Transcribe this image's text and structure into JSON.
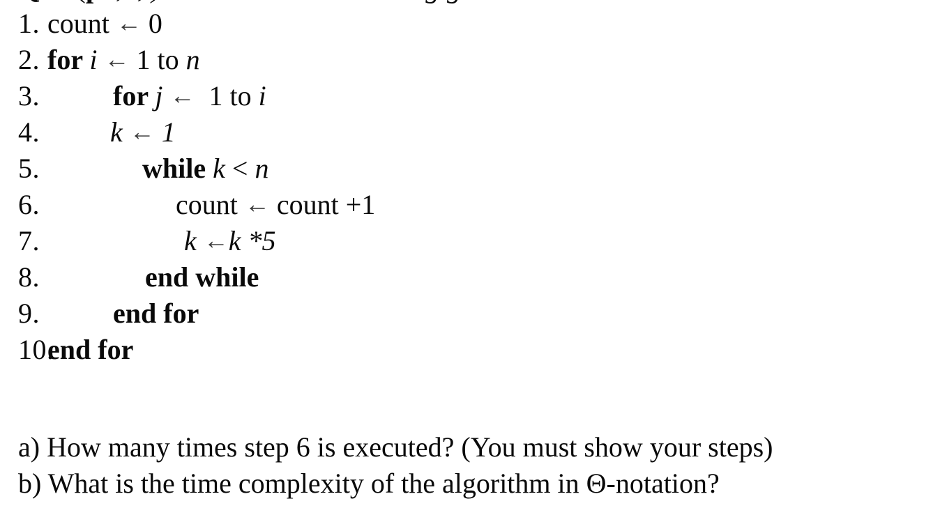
{
  "document": {
    "background_color": "#ffffff",
    "text_color": "#0a0a0a",
    "arrow_color": "#3a3a3a",
    "arrow_glyph": "←",
    "truncated_header": {
      "visible": "partial",
      "note": "top line clipped by page edge",
      "fragment_prefix": "Q",
      "fragment_paren": "(",
      "fragment_mid": "p",
      "fragment_commas": ", ,)",
      "fragment_suffix": "g g"
    }
  },
  "pseudocode": {
    "lines": [
      {
        "number": "1.",
        "indent": "ind0",
        "segments": [
          {
            "text": "count ",
            "style": "plain"
          },
          {
            "text": "←",
            "style": "arrow"
          },
          {
            "text": " 0",
            "style": "plain"
          }
        ]
      },
      {
        "number": "2.",
        "indent": "ind0",
        "segments": [
          {
            "text": "for ",
            "style": "kw"
          },
          {
            "text": "i ",
            "style": "var"
          },
          {
            "text": "←",
            "style": "arrow"
          },
          {
            "text": " 1 to ",
            "style": "plain"
          },
          {
            "text": "n",
            "style": "var"
          }
        ]
      },
      {
        "number": "3.",
        "indent": "ind1",
        "segments": [
          {
            "text": "for ",
            "style": "kw"
          },
          {
            "text": "j ",
            "style": "var"
          },
          {
            "text": "←",
            "style": "arrow"
          },
          {
            "text": "  1 to ",
            "style": "plain"
          },
          {
            "text": "i",
            "style": "var"
          }
        ]
      },
      {
        "number": "4.",
        "indent": "ind2",
        "segments": [
          {
            "text": "k ",
            "style": "var"
          },
          {
            "text": "←",
            "style": "arrow"
          },
          {
            "text": " 1",
            "style": "numit"
          }
        ]
      },
      {
        "number": "5.",
        "indent": "ind3",
        "segments": [
          {
            "text": "while ",
            "style": "kw"
          },
          {
            "text": "k ",
            "style": "var"
          },
          {
            "text": "< ",
            "style": "plain"
          },
          {
            "text": "n",
            "style": "var"
          }
        ]
      },
      {
        "number": "6.",
        "indent": "ind4",
        "segments": [
          {
            "text": "count ",
            "style": "plain"
          },
          {
            "text": "←",
            "style": "arrow"
          },
          {
            "text": " count +1",
            "style": "plain"
          }
        ]
      },
      {
        "number": "7.",
        "indent": "ind5",
        "segments": [
          {
            "text": "k ",
            "style": "var"
          },
          {
            "text": "←",
            "style": "arrow"
          },
          {
            "text": "k",
            "style": "var"
          },
          {
            "text": " *5",
            "style": "numit"
          }
        ]
      },
      {
        "number": "8.",
        "indent": "ind6",
        "segments": [
          {
            "text": "end while",
            "style": "kw"
          }
        ]
      },
      {
        "number": "9.",
        "indent": "ind7",
        "segments": [
          {
            "text": "end for",
            "style": "kw"
          }
        ]
      },
      {
        "number": "10.",
        "indent": "ind0",
        "segments": [
          {
            "text": "end for",
            "style": "kw"
          }
        ]
      }
    ]
  },
  "questions": {
    "a": "a) How many times step 6 is executed? (You must show your steps)",
    "b": "b) What is the time complexity of the algorithm in Θ-notation?"
  }
}
